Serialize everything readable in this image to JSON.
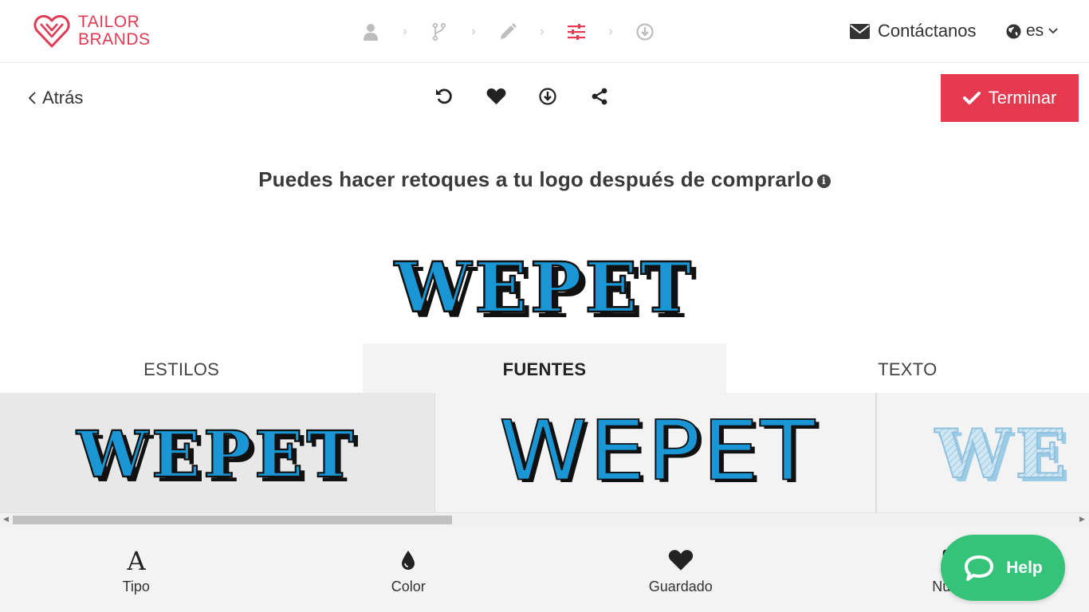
{
  "brand": {
    "line1": "TAILOR",
    "line2": "BRANDS",
    "color": "#e13a55"
  },
  "steps": [
    {
      "icon": "user-icon",
      "active": false
    },
    {
      "icon": "branch-icon",
      "active": false
    },
    {
      "icon": "pencil-icon",
      "active": false
    },
    {
      "icon": "sliders-icon",
      "active": true
    },
    {
      "icon": "download-circle-icon",
      "active": false
    }
  ],
  "header": {
    "contact_label": "Contáctanos",
    "language": "es"
  },
  "toolbar": {
    "back_label": "Atrás",
    "tools": [
      "undo-icon",
      "heart-icon",
      "download-icon",
      "share-icon"
    ],
    "finish_label": "Terminar"
  },
  "headline": "Puedes hacer retoques a tu logo después de comprarlo",
  "logo": {
    "text": "WEPET",
    "fill": "#1a96d4",
    "shadow": "#111111"
  },
  "tabs": [
    {
      "label": "ESTILOS",
      "active": false
    },
    {
      "label": "FUENTES",
      "active": true
    },
    {
      "label": "TEXTO",
      "active": false
    }
  ],
  "font_options": [
    {
      "text": "WEPET",
      "selected": true
    },
    {
      "text": "WEPET",
      "selected": false
    },
    {
      "text": "WE",
      "selected": false
    }
  ],
  "bottom_nav": [
    {
      "icon": "font-icon",
      "label": "Tipo"
    },
    {
      "icon": "drop-icon",
      "label": "Color"
    },
    {
      "icon": "heart-icon",
      "label": "Guardado"
    },
    {
      "icon": "new-icon",
      "label": "Nuevo"
    }
  ],
  "help": {
    "label": "Help",
    "color": "#35c37a"
  },
  "colors": {
    "accent": "#e5394f",
    "tab_bg": "#f3f3f3"
  }
}
